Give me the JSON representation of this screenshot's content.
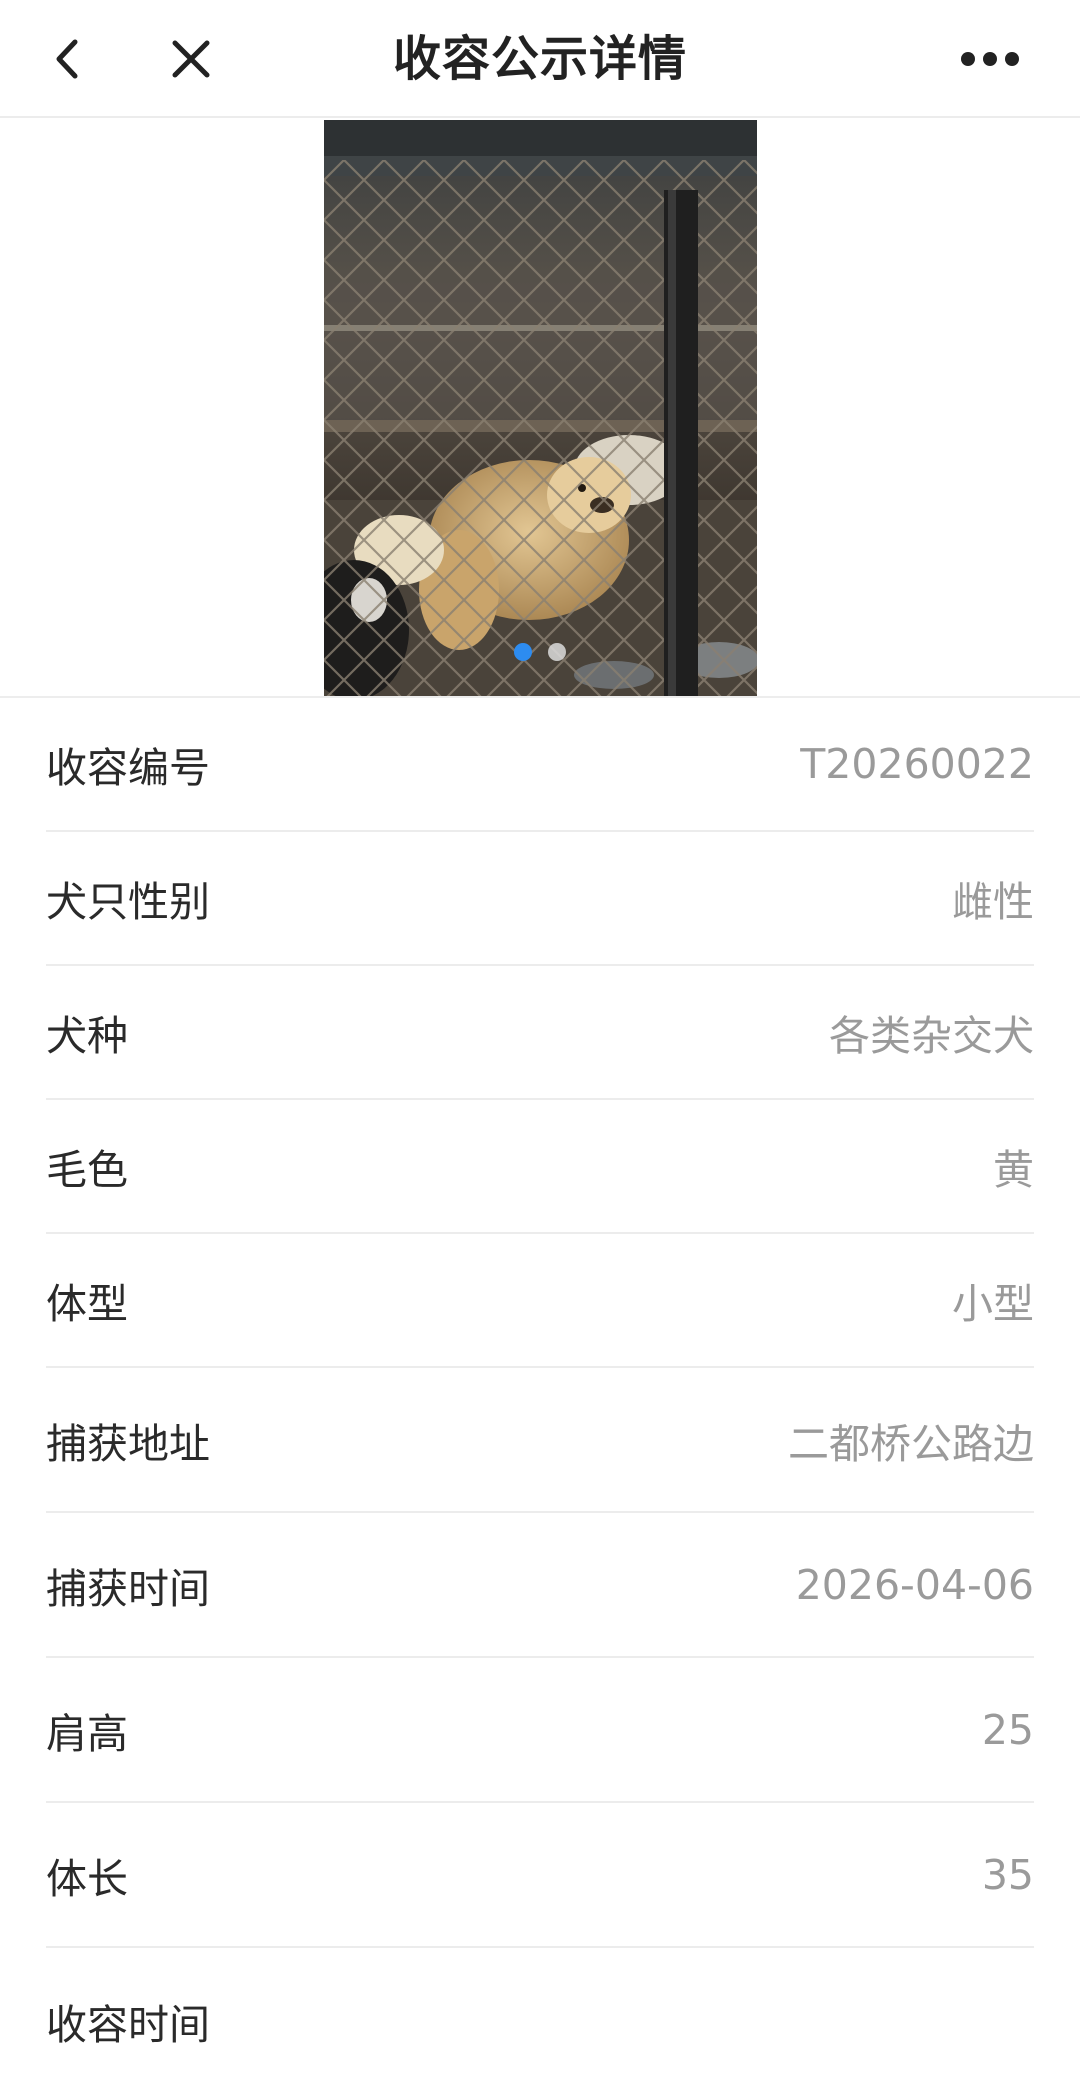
{
  "header": {
    "title": "收容公示详情",
    "back_icon": "chevron-left-icon",
    "close_icon": "close-icon",
    "more_icon": "more-horizontal-icon"
  },
  "carousel": {
    "image_subject": "dogs in cage photo",
    "slide_count": 2,
    "active_index": 1,
    "active_dot_color": "#2d8cf0"
  },
  "details": [
    {
      "label": "收容编号",
      "value": "T20260022"
    },
    {
      "label": "犬只性别",
      "value": "雌性"
    },
    {
      "label": "犬种",
      "value": "各类杂交犬"
    },
    {
      "label": "毛色",
      "value": "黄"
    },
    {
      "label": "体型",
      "value": "小型"
    },
    {
      "label": "捕获地址",
      "value": "二都桥公路边"
    },
    {
      "label": "捕获时间",
      "value": "2026-04-06"
    },
    {
      "label": "肩高",
      "value": "25"
    },
    {
      "label": "体长",
      "value": "35"
    },
    {
      "label": "收容时间",
      "value": ""
    }
  ]
}
